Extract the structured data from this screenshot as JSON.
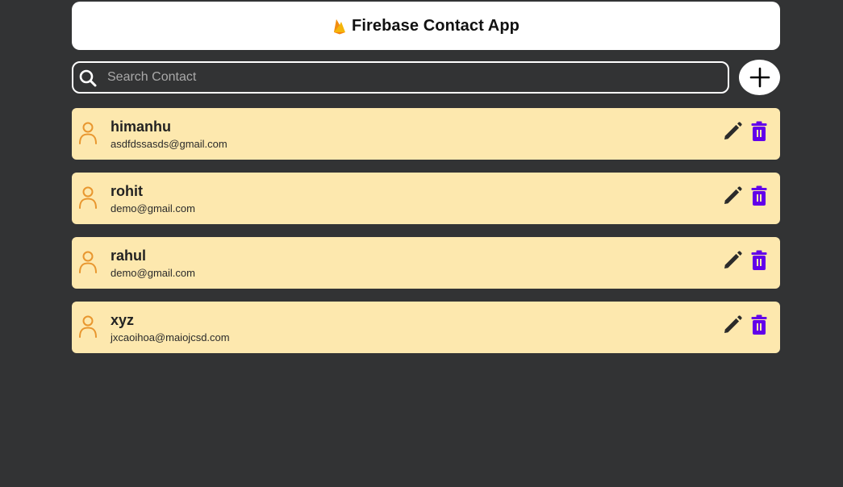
{
  "navbar": {
    "title": "Firebase Contact App",
    "logo_icon": "firebase-flame-icon"
  },
  "search": {
    "placeholder": "Search Contact",
    "value": "",
    "icon": "search-icon"
  },
  "add_button": {
    "icon": "plus-icon"
  },
  "contacts": [
    {
      "name": "himanhu",
      "email": "asdfdssasds@gmail.com"
    },
    {
      "name": "rohit",
      "email": "demo@gmail.com"
    },
    {
      "name": "rahul",
      "email": "demo@gmail.com"
    },
    {
      "name": "xyz",
      "email": "jxcaoihoa@maiojcsd.com"
    }
  ],
  "icons": {
    "avatar": "user-icon",
    "edit": "pencil-icon",
    "delete": "trash-icon"
  },
  "colors": {
    "background": "#323334",
    "card": "#fde8ae",
    "avatar": "#e8962e",
    "delete": "#6200ea",
    "edit": "#2b2b2b"
  }
}
